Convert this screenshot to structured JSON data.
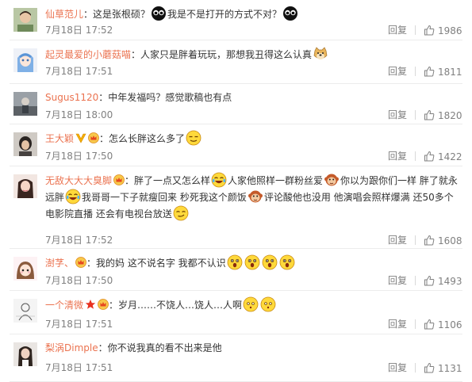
{
  "reply_label": "回复",
  "colors": {
    "username": "#eb7350",
    "meta": "#808080",
    "text": "#333333"
  },
  "comments": [
    {
      "username": "仙草范儿",
      "badges": [],
      "avatar": "avatar-photo-green",
      "segments": [
        {
          "t": "text",
          "v": "：这是张根硕？"
        },
        {
          "t": "emoji",
          "v": "black-face-emoji"
        },
        {
          "t": "text",
          "v": "我是不是打开的方式不对？"
        },
        {
          "t": "emoji",
          "v": "black-face-emoji"
        }
      ],
      "date": "7月18日 17:52",
      "likes": "1986"
    },
    {
      "username": "起灵最爱的小蘑菇喵",
      "badges": [],
      "avatar": "avatar-anime-blue-hair",
      "segments": [
        {
          "t": "text",
          "v": "：人家只是胖着玩玩，那想我丑得这么认真"
        },
        {
          "t": "emoji",
          "v": "doge-emoji"
        }
      ],
      "date": "7月18日 17:51",
      "likes": "1811"
    },
    {
      "username": "Sugus1120",
      "badges": [],
      "avatar": "avatar-photo-landscape",
      "segments": [
        {
          "t": "text",
          "v": "：中年发福吗？感觉歌稿也有点"
        }
      ],
      "date": "7月18日 18:00",
      "likes": "1820"
    },
    {
      "username": "王大颖",
      "badges": [
        "vip-v-badge",
        "member-crown-badge"
      ],
      "avatar": "avatar-photo-dark",
      "segments": [
        {
          "t": "text",
          "v": "：怎么长胖这么多了"
        },
        {
          "t": "emoji",
          "v": "awkward-smile-emoji"
        }
      ],
      "date": "7月18日 17:50",
      "likes": "1422"
    },
    {
      "username": "无敌大大大臭脚",
      "badges": [
        "member-crown-badge"
      ],
      "avatar": "avatar-photo-girl",
      "segments": [
        {
          "t": "text",
          "v": "：胖了一点又怎么样"
        },
        {
          "t": "emoji",
          "v": "laugh-tears-emoji"
        },
        {
          "t": "text",
          "v": "人家他照样一群粉丝爱"
        },
        {
          "t": "emoji",
          "v": "monkey-emoji"
        },
        {
          "t": "text",
          "v": "你以为跟你们一样 胖了就永远胖"
        },
        {
          "t": "emoji",
          "v": "laugh-tears-emoji"
        },
        {
          "t": "text",
          "v": "我哥哥一下子就瘦回来 秒死我这个颜饭"
        },
        {
          "t": "emoji",
          "v": "monkey-emoji"
        },
        {
          "t": "text",
          "v": "评论酸他也没用 他演唱会照样爆满 还50多个电影院直播 还会有电视台放送"
        },
        {
          "t": "emoji",
          "v": "smirk-emoji"
        }
      ],
      "date": "7月18日 17:52",
      "likes": "1608"
    },
    {
      "username": "澍芓、",
      "badges": [
        "member-crown-badge"
      ],
      "avatar": "avatar-cartoon-girl",
      "segments": [
        {
          "t": "text",
          "v": "：我的妈 这不说名字 我都不认识"
        },
        {
          "t": "emoji",
          "v": "shocked-emoji"
        },
        {
          "t": "emoji",
          "v": "shocked-emoji"
        },
        {
          "t": "emoji",
          "v": "shocked-emoji"
        },
        {
          "t": "emoji",
          "v": "shocked-emoji"
        }
      ],
      "date": "7月18日 17:50",
      "likes": "1493"
    },
    {
      "username": "一个清微",
      "badges": [
        "star-badge",
        "member-crown-badge"
      ],
      "avatar": "avatar-sketch",
      "segments": [
        {
          "t": "text",
          "v": "：岁月……不饶人…饶人…人啊"
        },
        {
          "t": "emoji",
          "v": "speechless-emoji"
        },
        {
          "t": "emoji",
          "v": "speechless-emoji"
        }
      ],
      "date": "7月18日 17:51",
      "likes": "1106"
    },
    {
      "username": "梨涡Dimple",
      "badges": [],
      "avatar": "avatar-photo-longhair",
      "segments": [
        {
          "t": "text",
          "v": "：你不说我真的看不出来是他"
        }
      ],
      "date": "7月18日 17:51",
      "likes": "1131"
    }
  ]
}
